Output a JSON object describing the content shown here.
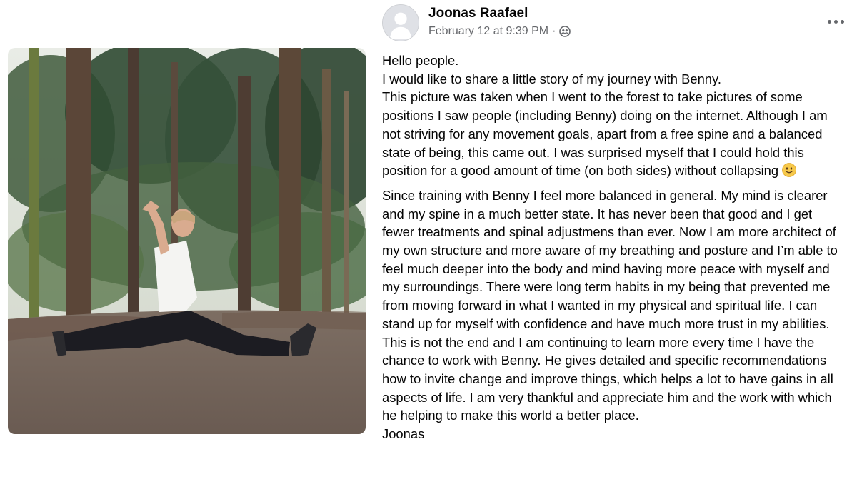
{
  "post": {
    "author": "Joonas Raafael",
    "timestamp": "February 12 at 9:39 PM",
    "separator": "·",
    "audience_icon": "friends-icon",
    "more_icon": "ellipsis-icon",
    "paragraphs": [
      "Hello people.",
      "I would like to share a little story of my journey with Benny.",
      "This picture was taken when I went to the forest to take pictures of some positions I saw people (including Benny) doing on the internet. Although I am not striving for any movement goals, apart from a free spine and a balanced state of being, this came out. I was surprised myself that I could hold this position for a good amount of time (on both sides) without collapsing"
    ],
    "emoji": "slightly-smiling-face",
    "paragraphs2": [
      "Since training with Benny I feel more balanced in general. My mind is clearer and my spine in a much better state. It has never been that good and I get fewer treatments and spinal adjustmens than ever. Now I am more architect of my own structure and more aware of my breathing and posture and I’m able to feel much deeper into the body and mind having more peace with myself and my surroundings. There were long term habits in my being that prevented me from moving forward in what I wanted in my physical and spiritual life. I can stand up for myself with confidence and have much more trust in my abilities. This is not the end and I am continuing to learn more every time I have the chance to work with Benny. He gives detailed and specific recommendations how to invite change and improve things, which helps a lot to have gains in all aspects of life. I am very thankful and appreciate him and the work with which he helping to make this world a better place.",
      "Joonas"
    ]
  },
  "colors": {
    "text": "#050505",
    "secondary": "#65676b",
    "avatar_bg": "#dfe1e6"
  }
}
